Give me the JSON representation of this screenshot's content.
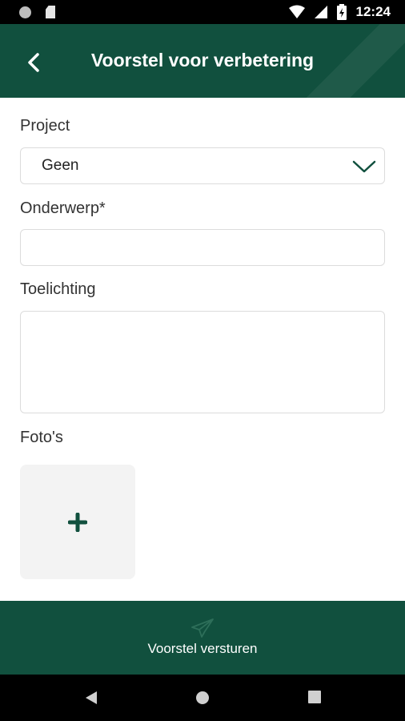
{
  "status_bar": {
    "time": "12:24"
  },
  "header": {
    "title": "Voorstel voor verbetering"
  },
  "form": {
    "project": {
      "label": "Project",
      "selected": "Geen"
    },
    "subject": {
      "label": "Onderwerp*",
      "value": ""
    },
    "description": {
      "label": "Toelichting",
      "value": ""
    },
    "photos": {
      "label": "Foto's"
    }
  },
  "footer": {
    "submit_label": "Voorstel versturen"
  },
  "colors": {
    "brand": "#11503e",
    "border": "#dcdcdc",
    "photo_bg": "#f3f3f3"
  },
  "icons": {
    "back": "chevron-left-icon",
    "dropdown": "chevron-down-icon",
    "add_photo": "plus-icon",
    "send": "paper-plane-icon"
  }
}
